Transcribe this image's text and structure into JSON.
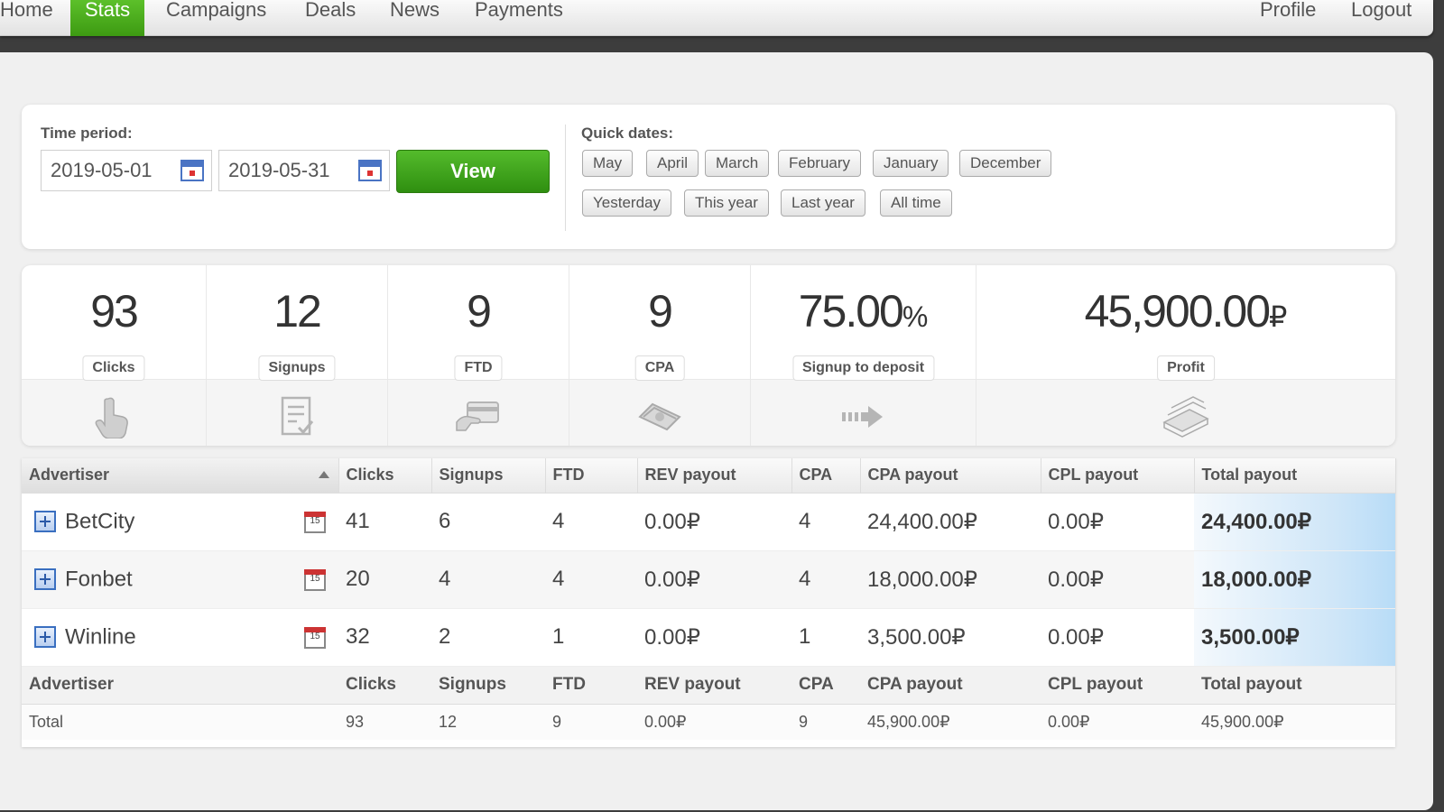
{
  "nav": {
    "items": [
      {
        "label": "Home",
        "active": false
      },
      {
        "label": "Stats",
        "active": true
      },
      {
        "label": "Campaigns",
        "active": false
      },
      {
        "label": "Deals",
        "active": false
      },
      {
        "label": "News",
        "active": false
      },
      {
        "label": "Payments",
        "active": false
      }
    ],
    "right": [
      {
        "label": "Profile"
      },
      {
        "label": "Logout"
      }
    ],
    "accent": "#4bad1e"
  },
  "filter": {
    "time_period_label": "Time period:",
    "date_from": "2019-05-01",
    "date_to": "2019-05-31",
    "view_label": "View",
    "quick_dates_label": "Quick dates:",
    "quick_row1": [
      "May",
      "April",
      "March",
      "February",
      "January",
      "December"
    ],
    "quick_row2": [
      "Yesterday",
      "This year",
      "Last year",
      "All time"
    ]
  },
  "stats": [
    {
      "value": "93",
      "unit": "",
      "label": "Clicks",
      "icon": "pointer-hand-icon"
    },
    {
      "value": "12",
      "unit": "",
      "label": "Signups",
      "icon": "form-check-icon"
    },
    {
      "value": "9",
      "unit": "",
      "label": "FTD",
      "icon": "credit-card-icon"
    },
    {
      "value": "9",
      "unit": "",
      "label": "CPA",
      "icon": "money-stack-icon"
    },
    {
      "value": "75.00",
      "unit": "%",
      "label": "Signup to deposit",
      "icon": "arrow-right-icon"
    },
    {
      "value": "45,900.00",
      "unit": "₽",
      "label": "Profit",
      "icon": "cash-pile-icon"
    }
  ],
  "table": {
    "headers": [
      "Advertiser",
      "Clicks",
      "Signups",
      "FTD",
      "REV payout",
      "CPA",
      "CPA payout",
      "CPL payout",
      "Total payout"
    ],
    "rows": [
      {
        "advertiser": "BetCity",
        "clicks": "41",
        "signups": "6",
        "ftd": "4",
        "rev_payout": "0.00₽",
        "cpa": "4",
        "cpa_payout": "24,400.00₽",
        "cpl_payout": "0.00₽",
        "total_payout": "24,400.00₽"
      },
      {
        "advertiser": "Fonbet",
        "clicks": "20",
        "signups": "4",
        "ftd": "4",
        "rev_payout": "0.00₽",
        "cpa": "4",
        "cpa_payout": "18,000.00₽",
        "cpl_payout": "0.00₽",
        "total_payout": "18,000.00₽"
      },
      {
        "advertiser": "Winline",
        "clicks": "32",
        "signups": "2",
        "ftd": "1",
        "rev_payout": "0.00₽",
        "cpa": "1",
        "cpa_payout": "3,500.00₽",
        "cpl_payout": "0.00₽",
        "total_payout": "3,500.00₽"
      }
    ],
    "calendar_day": "15",
    "footer_headers": [
      "Advertiser",
      "Clicks",
      "Signups",
      "FTD",
      "REV payout",
      "CPA",
      "CPA payout",
      "CPL payout",
      "Total payout"
    ],
    "totals": {
      "advertiser": "Total",
      "clicks": "93",
      "signups": "12",
      "ftd": "9",
      "rev_payout": "0.00₽",
      "cpa": "9",
      "cpa_payout": "45,900.00₽",
      "cpl_payout": "0.00₽",
      "total_payout": "45,900.00₽"
    }
  }
}
